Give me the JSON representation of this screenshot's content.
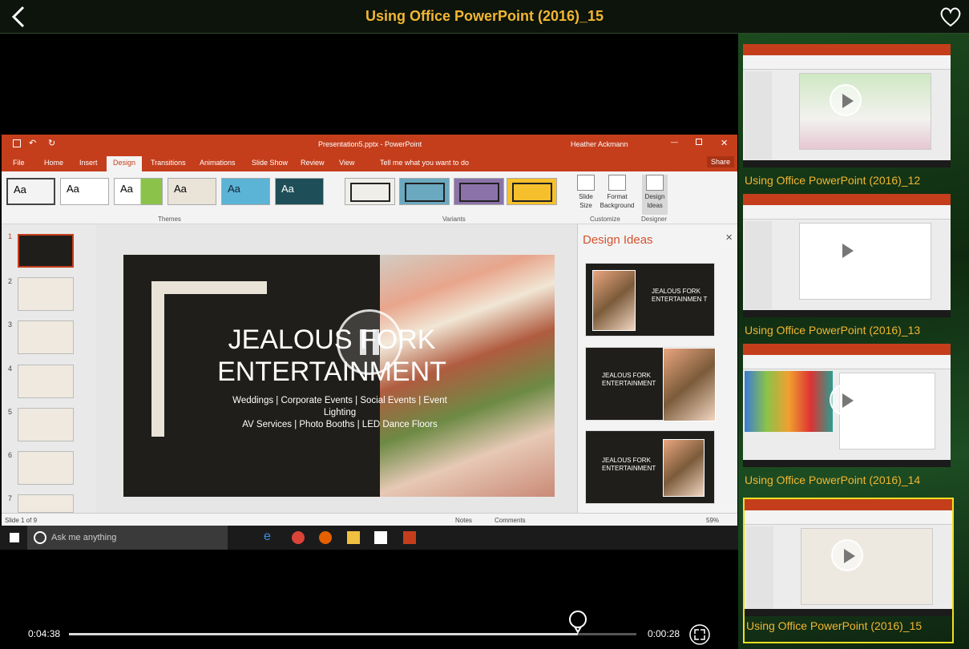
{
  "header": {
    "title": "Using Office PowerPoint (2016)_15"
  },
  "powerpoint": {
    "window_title": "Presentation5.pptx - PowerPoint",
    "user": "Heather Ackmann",
    "tabs": [
      "File",
      "Home",
      "Insert",
      "Design",
      "Transitions",
      "Animations",
      "Slide Show",
      "Review",
      "View"
    ],
    "active_tab": "Design",
    "tell_me": "Tell me what you want to do",
    "share": "Share",
    "theme_sample": "Aa",
    "group_themes": "Themes",
    "group_variants": "Variants",
    "group_customize": "Customize",
    "group_designer": "Designer",
    "slide_size": "Slide Size",
    "format_background": "Format Background",
    "design_ideas_btn": "Design Ideas",
    "design_ideas_pane_title": "Design Ideas",
    "slide": {
      "title_line1": "JEALOUS FORK",
      "title_line2": "ENTERTAINMENT",
      "subtitle_line1": "Weddings | Corporate Events | Social Events | Event",
      "subtitle_line2": "Lighting",
      "subtitle_line3": "AV Services | Photo Booths | LED Dance Floors"
    },
    "idea_title_1": "JEALOUS FORK ENTERTAINMEN T",
    "idea_title_2": "JEALOUS FORK ENTERTAINMENT",
    "idea_title_3": "JEALOUS FORK ENTERTAINMENT",
    "thumb_numbers": [
      "1",
      "2",
      "3",
      "4",
      "5",
      "6",
      "7"
    ],
    "status_slide": "Slide 1 of 9",
    "status_notes": "Notes",
    "status_comments": "Comments",
    "zoom": "59%"
  },
  "taskbar": {
    "search_placeholder": "Ask me anything"
  },
  "player": {
    "elapsed": "0:04:38",
    "remaining": "0:00:28",
    "progress": 0.897
  },
  "playlist": [
    {
      "title": "Using Office PowerPoint (2016)_12",
      "selected": false
    },
    {
      "title": "Using Office PowerPoint (2016)_13",
      "selected": false
    },
    {
      "title": "Using Office PowerPoint (2016)_14",
      "selected": false
    },
    {
      "title": "Using Office PowerPoint (2016)_15",
      "selected": true
    }
  ],
  "colors": {
    "accent_title": "#f2b632",
    "ppt_red": "#c43e1c",
    "selected_border": "#f0e020"
  },
  "icons": {
    "back": "chevron-left-icon",
    "favorite": "heart-icon",
    "pause": "pause-icon",
    "fullscreen": "fullscreen-icon",
    "play": "play-icon"
  }
}
